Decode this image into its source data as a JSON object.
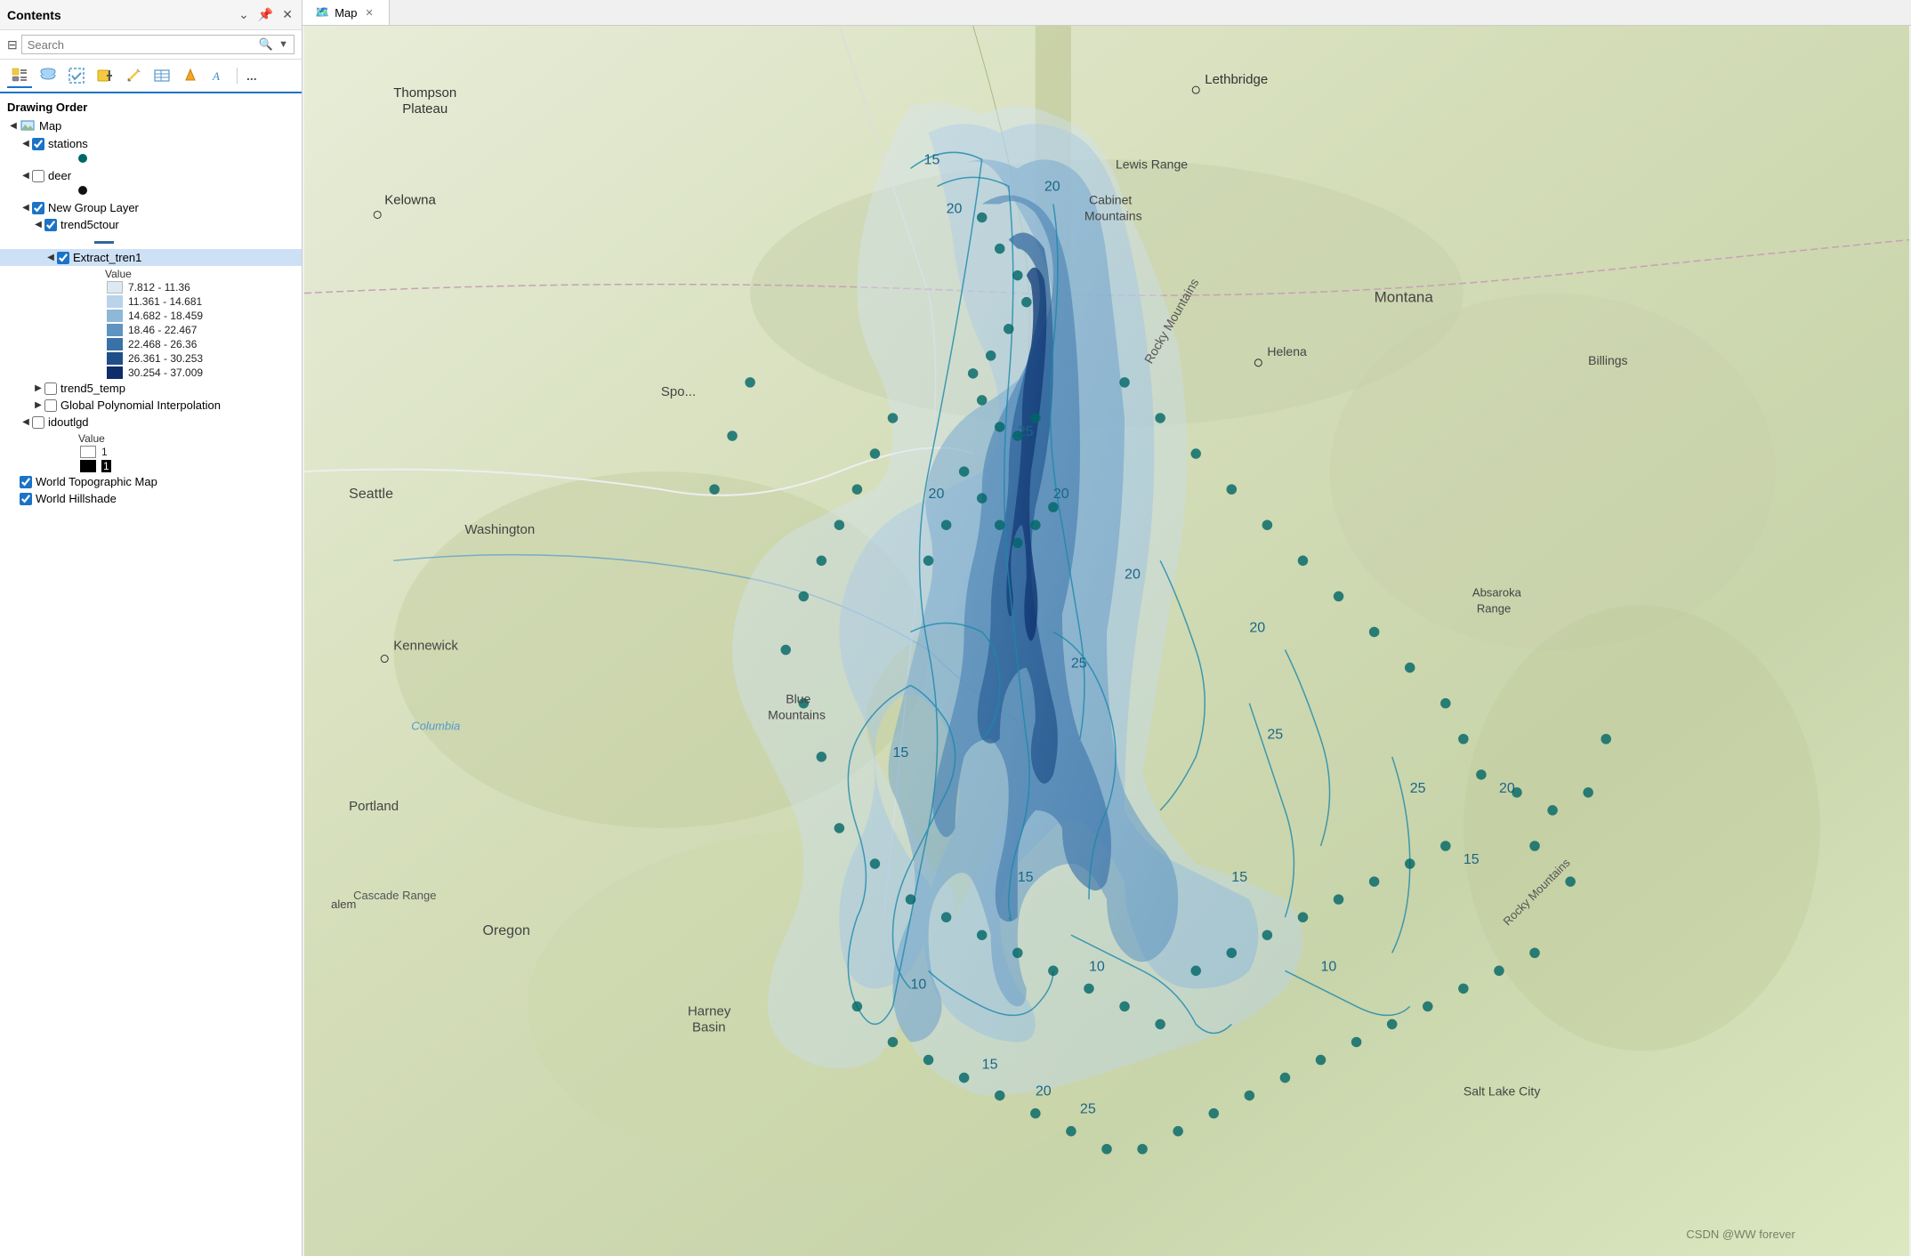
{
  "panel": {
    "title": "Contents",
    "header_icons": [
      "collapse",
      "pin",
      "close"
    ]
  },
  "search": {
    "placeholder": "Search"
  },
  "toolbar": {
    "items": [
      {
        "name": "list-by-drawing-order",
        "icon": "📋",
        "label": "List by drawing order",
        "active": true
      },
      {
        "name": "list-by-data-source",
        "icon": "🗄️",
        "label": "List by data source"
      },
      {
        "name": "list-by-selection",
        "icon": "🔲",
        "label": "List by selection"
      },
      {
        "name": "add-layer",
        "icon": "➕",
        "label": "Add layer"
      },
      {
        "name": "add-graphics-layer",
        "icon": "✏️",
        "label": "Add graphics layer"
      },
      {
        "name": "add-group-layer",
        "icon": "📁",
        "label": "Add group layer"
      },
      {
        "name": "more",
        "icon": "...",
        "label": "More"
      }
    ]
  },
  "section": {
    "drawing_order_label": "Drawing Order"
  },
  "layers": [
    {
      "id": "map",
      "label": "Map",
      "indent": 0,
      "expanded": true,
      "has_checkbox": false,
      "has_map_icon": true,
      "children": [
        {
          "id": "stations",
          "label": "stations",
          "indent": 1,
          "expanded": true,
          "has_checkbox": true,
          "checked": true,
          "has_legend": false,
          "symbol": {
            "type": "circle",
            "color": "#006666"
          }
        },
        {
          "id": "deer",
          "label": "deer",
          "indent": 1,
          "expanded": true,
          "has_checkbox": true,
          "checked": false,
          "has_legend": false,
          "symbol": {
            "type": "circle",
            "color": "#222222"
          }
        },
        {
          "id": "new-group-layer",
          "label": "New Group Layer",
          "indent": 1,
          "expanded": true,
          "has_checkbox": true,
          "checked": true,
          "children": [
            {
              "id": "trend5ctour",
              "label": "trend5ctour",
              "indent": 2,
              "expanded": true,
              "has_checkbox": true,
              "checked": true,
              "symbol": {
                "type": "line",
                "color": "#336699"
              },
              "children": [
                {
                  "id": "extract-tren1",
                  "label": "Extract_tren1",
                  "indent": 3,
                  "expanded": true,
                  "has_checkbox": true,
                  "checked": true,
                  "selected": true,
                  "legend_header": "Value",
                  "legend": [
                    {
                      "color": "#dce9f5",
                      "label": "7.812 - 11.36"
                    },
                    {
                      "color": "#b8d3ea",
                      "label": "11.361 - 14.681"
                    },
                    {
                      "color": "#8db8d8",
                      "label": "14.682 - 18.459"
                    },
                    {
                      "color": "#5e94bf",
                      "label": "18.46 - 22.467"
                    },
                    {
                      "color": "#3a72a8",
                      "label": "22.468 - 26.36"
                    },
                    {
                      "color": "#1e4f88",
                      "label": "26.361 - 30.253"
                    },
                    {
                      "color": "#0d2d6b",
                      "label": "30.254 - 37.009"
                    }
                  ]
                }
              ]
            },
            {
              "id": "trend5-temp",
              "label": "trend5_temp",
              "indent": 2,
              "expanded": false,
              "has_checkbox": true,
              "checked": false
            },
            {
              "id": "global-polynomial",
              "label": "Global Polynomial Interpolation",
              "indent": 2,
              "expanded": false,
              "has_checkbox": true,
              "checked": false
            }
          ]
        },
        {
          "id": "idoutlgd",
          "label": "idoutlgd",
          "indent": 1,
          "expanded": true,
          "has_checkbox": true,
          "checked": false,
          "legend_header": "Value",
          "legend": [
            {
              "color": "#ffffff",
              "label": "1",
              "border": "#888"
            },
            {
              "color": "#000000",
              "label": "1"
            }
          ]
        }
      ]
    }
  ],
  "bottom_layers": [
    {
      "id": "world-topographic-map",
      "label": "World Topographic Map",
      "checked": true
    },
    {
      "id": "world-hillshade",
      "label": "World Hillshade",
      "checked": true
    }
  ],
  "map": {
    "tab_label": "Map",
    "tab_icon": "🗺️",
    "watermark": "CSDN @WW  forever",
    "places": [
      {
        "name": "Thompson\nPlateau",
        "x": "9%",
        "y": "8%"
      },
      {
        "name": "Kelowna",
        "x": "10%",
        "y": "16%"
      },
      {
        "name": "Lethbridge",
        "x": "60%",
        "y": "6%"
      },
      {
        "name": "Cabinet\nMountains",
        "x": "53%",
        "y": "22%"
      },
      {
        "name": "Lewis Range",
        "x": "55%",
        "y": "17%"
      },
      {
        "name": "Montana",
        "x": "74%",
        "y": "27%"
      },
      {
        "name": "Helena",
        "x": "68%",
        "y": "31%"
      },
      {
        "name": "Billings",
        "x": "88%",
        "y": "32%"
      },
      {
        "name": "Rocky\nMountains",
        "x": "62%",
        "y": "35%"
      },
      {
        "name": "Spo...",
        "x": "26%",
        "y": "35%"
      },
      {
        "name": "Seattle",
        "x": "8%",
        "y": "44%"
      },
      {
        "name": "Washington",
        "x": "18%",
        "y": "47%"
      },
      {
        "name": "Kennewick",
        "x": "18%",
        "y": "58%"
      },
      {
        "name": "Columbia",
        "x": "15%",
        "y": "65%"
      },
      {
        "name": "Blue\nMountains",
        "x": "40%",
        "y": "64%"
      },
      {
        "name": "Portland",
        "x": "8%",
        "y": "72%"
      },
      {
        "name": "Cascade Range",
        "x": "9%",
        "y": "76%"
      },
      {
        "name": "Absaroka\nRange",
        "x": "78%",
        "y": "55%"
      },
      {
        "name": "alem",
        "x": "8%",
        "y": "80%"
      },
      {
        "name": "Oregon",
        "x": "17%",
        "y": "83%"
      },
      {
        "name": "Harney\nBasin",
        "x": "34%",
        "y": "90%"
      },
      {
        "name": "Salt Lake City",
        "x": "80%",
        "y": "98%"
      },
      {
        "name": "Rocky\nMountains",
        "x": "85%",
        "y": "82%"
      },
      {
        "name": "Rocky\nMountains",
        "x": "85%",
        "y": "82%"
      }
    ],
    "contour_values": [
      "15",
      "20",
      "20",
      "25",
      "20",
      "25",
      "15",
      "10",
      "15",
      "10",
      "15",
      "20",
      "25"
    ]
  }
}
